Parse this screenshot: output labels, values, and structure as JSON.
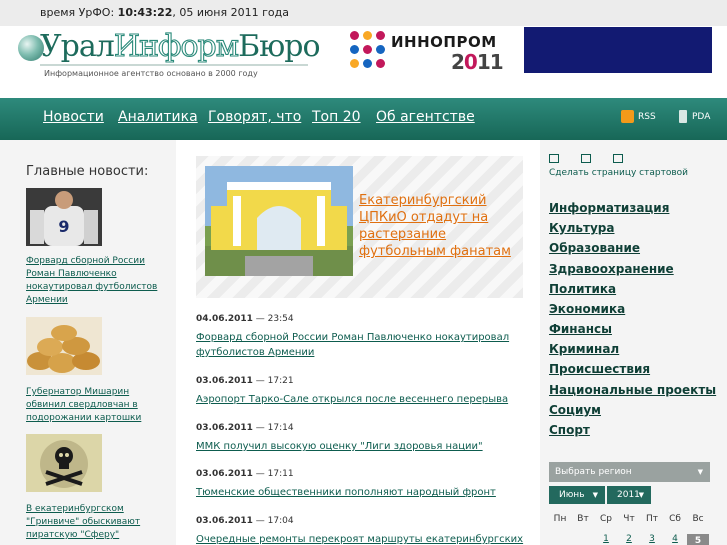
{
  "topbar": {
    "label": "время УрФО:",
    "time": "10:43:22",
    "date": ", 05 июня 2011 года"
  },
  "header": {
    "logo_part1": "Урал",
    "logo_part2": "Информ",
    "logo_part3": "Бюро",
    "tagline": "Информационное агентство основано в 2000 году",
    "banner_name": "ИННОПРОМ",
    "banner_year_prefix": "2",
    "banner_year_accent": "0",
    "banner_year_suffix": "11"
  },
  "nav": {
    "items": [
      "Новости",
      "Аналитика",
      "Говорят, что",
      "Топ 20",
      "Об агентстве"
    ],
    "rss_label": "RSS",
    "pda_label": "PDA"
  },
  "left": {
    "heading": "Главные новости:",
    "items": [
      {
        "caption": "Форвард сборной России Роман Павлюченко нокаутировал футболистов Армении"
      },
      {
        "caption": "Губернатор Мишарин обвинил свердловчан в подорожании картошки"
      },
      {
        "caption": "В екатеринбургском \"Гринвиче\" обыскивают пиратскую \"Сферу\""
      }
    ]
  },
  "feature": {
    "title": "Екатеринбургский ЦПКиО отдадут на растерзание футбольным фанатам"
  },
  "news": [
    {
      "date": "04.06.2011",
      "time": " — 23:54",
      "title": "Форвард сборной России Роман Павлюченко нокаутировал футболистов Армении"
    },
    {
      "date": "03.06.2011",
      "time": " — 17:21",
      "title": "Аэропорт Тарко-Сале открылся после весеннего перерыва"
    },
    {
      "date": "03.06.2011",
      "time": " — 17:14",
      "title": "ММК получил высокую оценку \"Лиги здоровья нации\""
    },
    {
      "date": "03.06.2011",
      "time": " — 17:11",
      "title": "Тюменские общественники пополняют народный фронт"
    },
    {
      "date": "03.06.2011",
      "time": " — 17:04",
      "title": "Очередные ремонты перекроят маршруты екатеринбургских"
    }
  ],
  "right": {
    "start_page": "Сделать страницу стартовой",
    "categories": [
      "Информатизация",
      "Культура",
      "Образование",
      "Здравоохранение",
      "Политика",
      "Экономика",
      "Финансы",
      "Криминал",
      "Происшествия",
      "Национальные проекты",
      "Социум",
      "Спорт"
    ],
    "region_placeholder": "Выбрать регион",
    "month": "Июнь",
    "year": "2011",
    "weekdays": [
      "Пн",
      "Вт",
      "Ср",
      "Чт",
      "Пт",
      "Сб",
      "Вс"
    ],
    "days": [
      "1",
      "2",
      "3",
      "4",
      "5"
    ]
  }
}
